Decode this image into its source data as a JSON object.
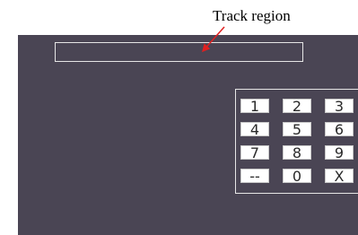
{
  "annotation": {
    "label": "Track region"
  },
  "keypad": {
    "keys": [
      "1",
      "2",
      "3",
      "4",
      "5",
      "6",
      "7",
      "8",
      "9",
      "--",
      "0",
      "X"
    ]
  },
  "colors": {
    "screen": "#4a4554",
    "outline": "#e6e6e6",
    "arrow": "#e02020",
    "key": "#ffffff"
  }
}
